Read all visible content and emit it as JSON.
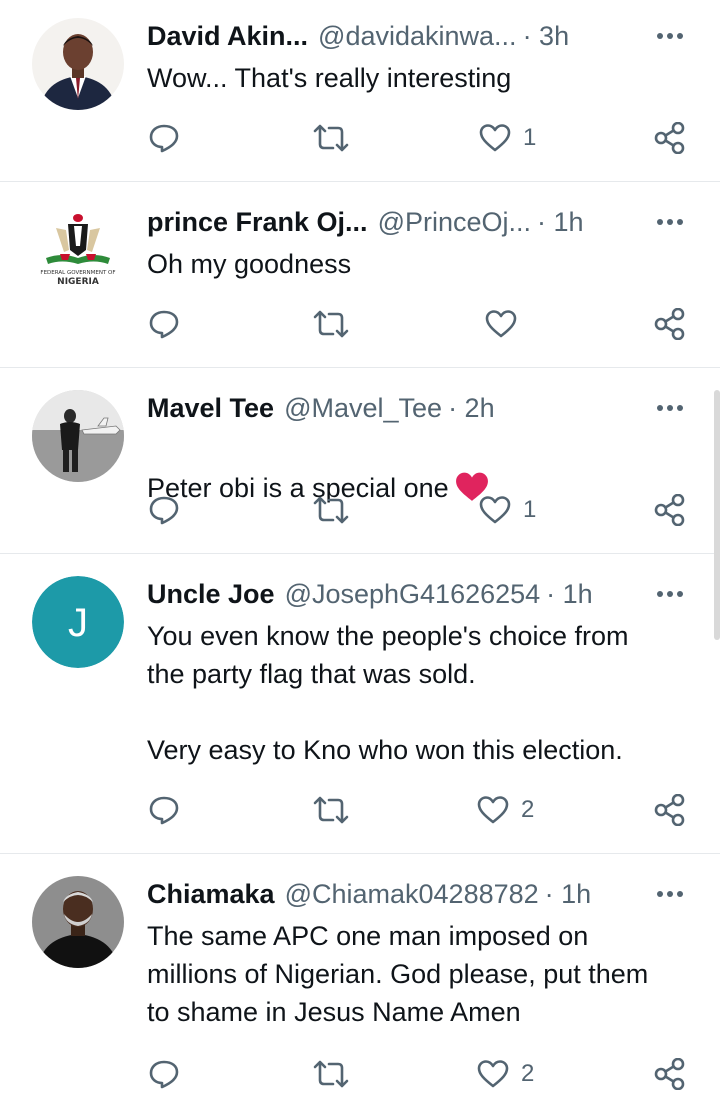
{
  "tweets": [
    {
      "name": "David Akin...",
      "handle": "@davidakinwa...",
      "time": "· 3h",
      "text": "Wow... That's really interesting",
      "likes": "1",
      "avatar": "portrait-suit"
    },
    {
      "name": "prince Frank Oj...",
      "handle": "@PrinceOj...",
      "time": "· 1h",
      "text": "Oh my goodness",
      "likes": "",
      "avatar": "coat-of-arms",
      "avatar_caption_top": "FEDERAL GOVERNMENT OF",
      "avatar_caption": "NIGERIA"
    },
    {
      "name": "Mavel Tee",
      "handle": "@Mavel_Tee",
      "time": "· 2h",
      "text": "Peter obi is a special one",
      "likes": "1",
      "avatar": "bw-jet-photo",
      "emoji": "red-heart"
    },
    {
      "name": "Uncle Joe",
      "handle": "@JosephG41626254",
      "time": "· 1h",
      "text": "You even know the people's choice from\nthe party flag that was sold.\n\nVery easy to Kno who won this election.",
      "likes": "2",
      "avatar": "letter-J",
      "avatar_letter": "J",
      "avatar_color": "#1d9aa8"
    },
    {
      "name": "Chiamaka",
      "handle": "@Chiamak04288782",
      "time": "· 1h",
      "text": "The same APC one man imposed on\nmillions of Nigerian. God please, put them\nto shame in Jesus Name Amen",
      "likes": "2",
      "avatar": "portrait-dark"
    }
  ],
  "colors": {
    "text": "#0f1419",
    "secondary": "#536471",
    "divider": "#e6e9ec",
    "heart_emoji": "#e0245e"
  },
  "icons": [
    "reply-icon",
    "retweet-icon",
    "like-icon",
    "share-icon",
    "more-icon"
  ]
}
